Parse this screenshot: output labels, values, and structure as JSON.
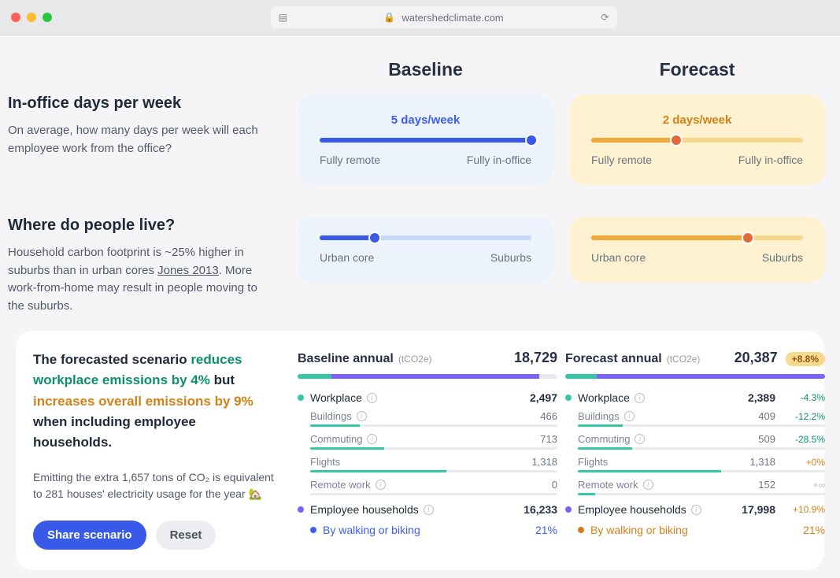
{
  "browser": {
    "url": "watershedclimate.com"
  },
  "columns": {
    "baseline": "Baseline",
    "forecast": "Forecast"
  },
  "rows": {
    "office": {
      "title": "In-office days per week",
      "desc": "On average, how many days per week will each employee work from the office?",
      "endLeft": "Fully remote",
      "endRight": "Fully in-office",
      "baseline": {
        "label": "5 days/week",
        "pct": 100
      },
      "forecast": {
        "label": "2 days/week",
        "pct": 40
      }
    },
    "live": {
      "title": "Where do people live?",
      "desc1": "Household carbon footprint is ~25% higher in suburbs than in urban cores ",
      "cite": "Jones 2013",
      "desc2": ". More work-from-home may result in people moving to the suburbs.",
      "endLeft": "Urban core",
      "endRight": "Suburbs",
      "baseline": {
        "pct": 26
      },
      "forecast": {
        "pct": 74
      }
    }
  },
  "summary": {
    "lead1": "The forecasted scenario ",
    "hlA": "reduces workplace emissions by 4%",
    "mid": " but ",
    "hlB": "increases overall emissions by 9%",
    "lead2": " when including employee households.",
    "para": "Emitting the extra 1,657 tons of CO₂ is equivalent to 281 houses' electricity usage for the year 🏡",
    "shareBtn": "Share scenario",
    "resetBtn": "Reset"
  },
  "annual": {
    "unit": "(tCO2e)",
    "baseline": {
      "title": "Baseline annual",
      "total": "18,729",
      "segTeal": 13,
      "segPurple": 80,
      "workplace": {
        "label": "Workplace",
        "val": "2,497"
      },
      "buildings": {
        "label": "Buildings",
        "val": "466",
        "bar": 20
      },
      "commuting": {
        "label": "Commuting",
        "val": "713",
        "bar": 30
      },
      "flights": {
        "label": "Flights",
        "val": "1,318",
        "bar": 55
      },
      "remote": {
        "label": "Remote work",
        "val": "0",
        "bar": 0
      },
      "households": {
        "label": "Employee households",
        "val": "16,233"
      },
      "walking": {
        "label": "By walking or biking",
        "val": "21%"
      }
    },
    "forecast": {
      "title": "Forecast annual",
      "total": "20,387",
      "badge": "+8.8%",
      "segTeal": 12,
      "segPurple": 88,
      "workplace": {
        "label": "Workplace",
        "val": "2,389",
        "delta": "-4.3%"
      },
      "buildings": {
        "label": "Buildings",
        "val": "409",
        "delta": "-12.2%",
        "bar": 18
      },
      "commuting": {
        "label": "Commuting",
        "val": "509",
        "delta": "-28.5%",
        "bar": 22
      },
      "flights": {
        "label": "Flights",
        "val": "1,318",
        "delta": "+0%",
        "bar": 58
      },
      "remote": {
        "label": "Remote work",
        "val": "152",
        "delta": "+∞",
        "bar": 7
      },
      "households": {
        "label": "Employee households",
        "val": "17,998",
        "delta": "+10.9%"
      },
      "walking": {
        "label": "By walking or biking",
        "val": "21%"
      }
    }
  }
}
